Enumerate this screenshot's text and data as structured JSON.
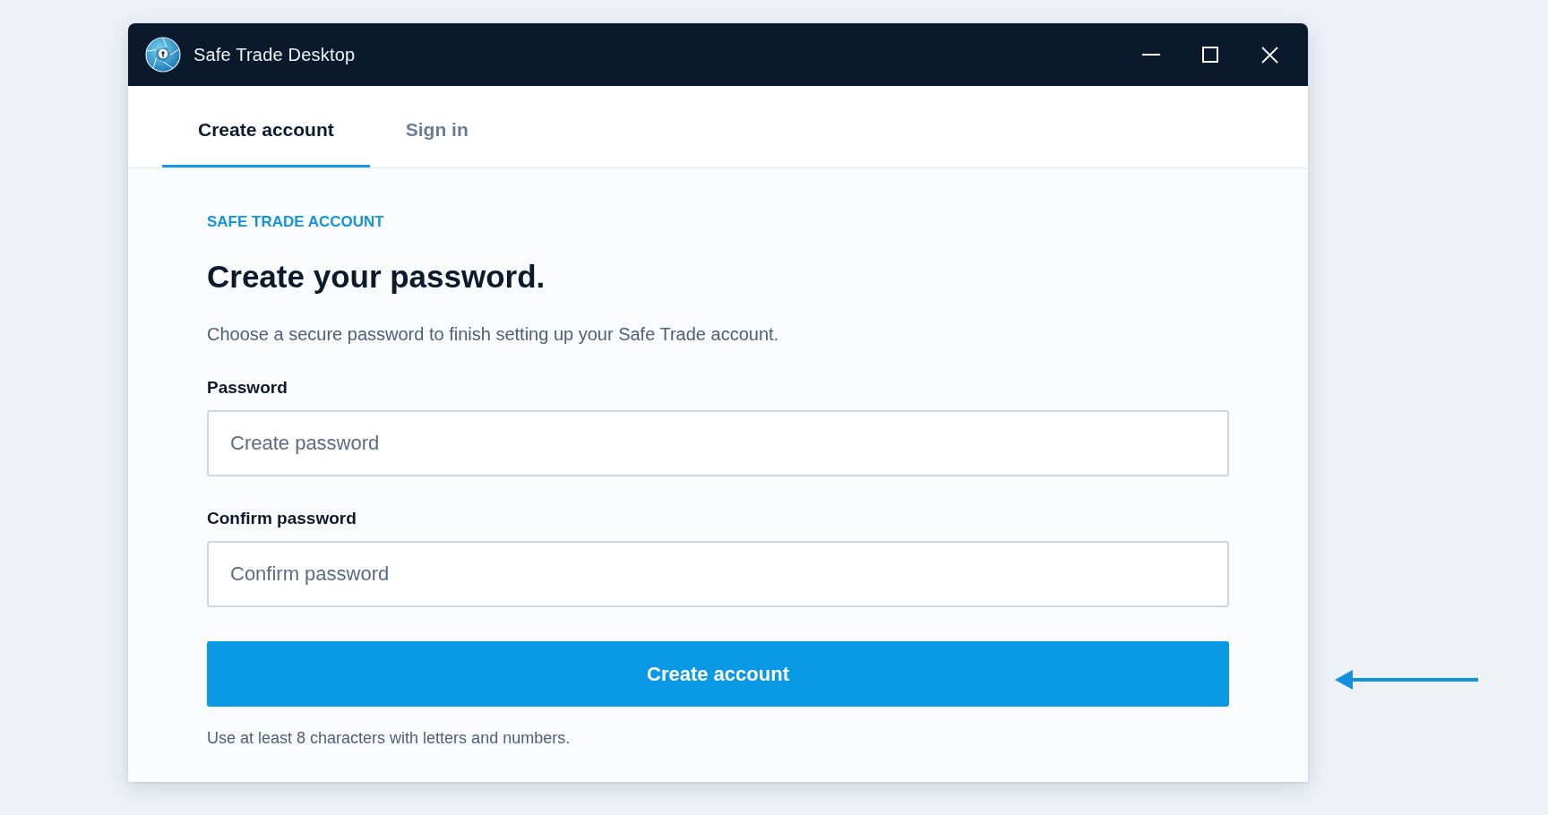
{
  "window": {
    "title": "Safe Trade Desktop"
  },
  "tabs": [
    {
      "label": "Create account",
      "selected": true
    },
    {
      "label": "Sign in",
      "selected": false
    }
  ],
  "form": {
    "eyebrow": "SAFE TRADE ACCOUNT",
    "heading": "Create your password.",
    "description": "Choose a secure password to finish setting up your Safe Trade account.",
    "fields": [
      {
        "label": "Password",
        "placeholder": "Create password"
      },
      {
        "label": "Confirm password",
        "placeholder": "Confirm password"
      }
    ],
    "submit": "Create account",
    "hint": "Use at least 8 characters with letters and numbers."
  }
}
